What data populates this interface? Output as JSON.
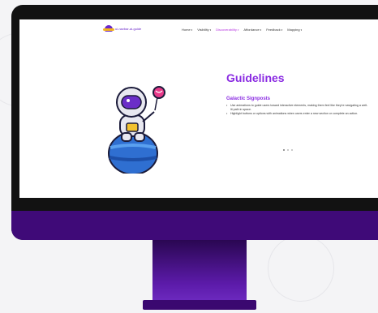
{
  "nav": {
    "logo_text": "ui-navbar-ai-guide",
    "items": [
      {
        "label": "Home",
        "active": false
      },
      {
        "label": "Visibility",
        "active": false
      },
      {
        "label": "Discoverability",
        "active": true
      },
      {
        "label": "Affordance",
        "active": false
      },
      {
        "label": "Feedback",
        "active": false
      },
      {
        "label": "Mapping",
        "active": false
      }
    ]
  },
  "content": {
    "title": "Guidelines",
    "subtitle": "Galactic Signposts",
    "bullets": [
      "Use animations to guide users toward interactive elements, making them feel like they're navigating a well-lit path in space.",
      "Highlight buttons or options with animations when users enter a new section or complete an action."
    ]
  },
  "carousel": {
    "count": 3,
    "active_index": 0
  },
  "colors": {
    "accent": "#8a2be2",
    "nav_active": "#b531e0",
    "chin": "#3f0a78",
    "bezel": "#121212"
  }
}
